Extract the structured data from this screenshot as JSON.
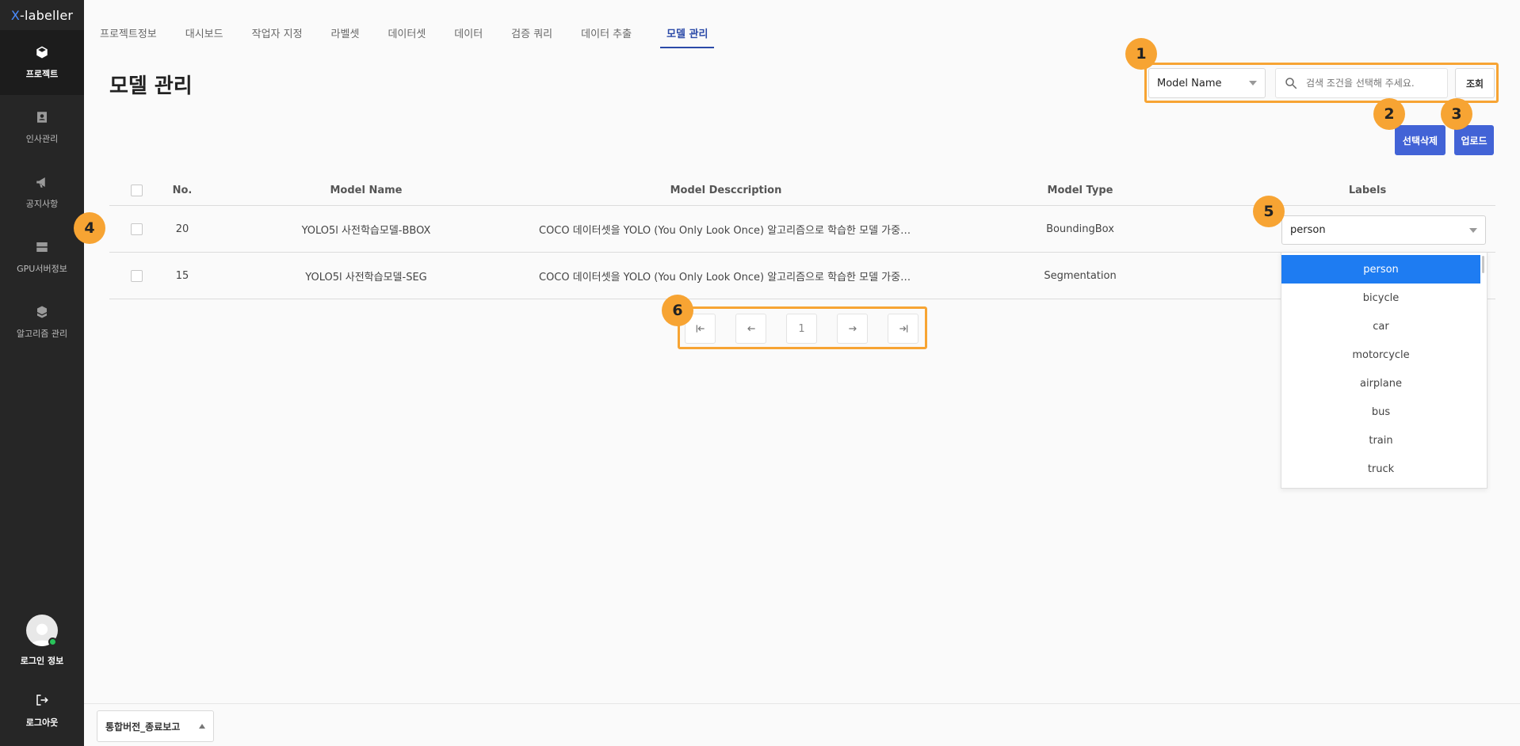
{
  "brand": {
    "prefix": "X",
    "suffix": "-labeller"
  },
  "sidebar": {
    "items": [
      {
        "label": "프로젝트",
        "icon": "cube-icon"
      },
      {
        "label": "인사관리",
        "icon": "person-badge-icon"
      },
      {
        "label": "공지사항",
        "icon": "megaphone-icon"
      },
      {
        "label": "GPU서버정보",
        "icon": "server-icon"
      },
      {
        "label": "알고리즘 관리",
        "icon": "cubes-icon"
      }
    ],
    "user_label": "로그인 정보",
    "logout_label": "로그아웃"
  },
  "tabs": [
    "프로젝트정보",
    "대시보드",
    "작업자 지정",
    "라벨셋",
    "데이터셋",
    "데이터",
    "검증 쿼리",
    "데이터 추출",
    "모델 관리"
  ],
  "page_title": "모델 관리",
  "search": {
    "select_value": "Model Name",
    "placeholder": "검색 조건을 선택해 주세요.",
    "query_button": "조회"
  },
  "actions": {
    "delete_selected": "선택삭제",
    "upload": "업로드"
  },
  "badges": [
    "1",
    "2",
    "3",
    "4",
    "5",
    "6"
  ],
  "table": {
    "headers": [
      "No.",
      "Model Name",
      "Model Desccription",
      "Model Type",
      "Labels"
    ],
    "rows": [
      {
        "no": "20",
        "name": "YOLO5l 사전학습모델-BBOX",
        "desc": "COCO 데이터셋을 YOLO (You Only Look Once) 알고리즘으로 학습한 모델 가중치 파일입니다. YOLO는 객체 감지(…",
        "type": "BoundingBox"
      },
      {
        "no": "15",
        "name": "YOLO5l 사전학습모델-SEG",
        "desc": "COCO 데이터셋을 YOLO (You Only Look Once) 알고리즘으로 학습한 모델 가중치 파일입니다. YOLO는 객체 감지(…",
        "type": "Segmentation"
      }
    ]
  },
  "labels_select": {
    "value": "person",
    "options": [
      "person",
      "bicycle",
      "car",
      "motorcycle",
      "airplane",
      "bus",
      "train",
      "truck"
    ]
  },
  "pagination": {
    "current_page": "1"
  },
  "footer": {
    "version": "통합버전_종료보고"
  },
  "colors": {
    "accent": "#4263d6",
    "highlight": "#f7a433",
    "selected": "#1e7cf2",
    "sidebar": "#262626"
  }
}
